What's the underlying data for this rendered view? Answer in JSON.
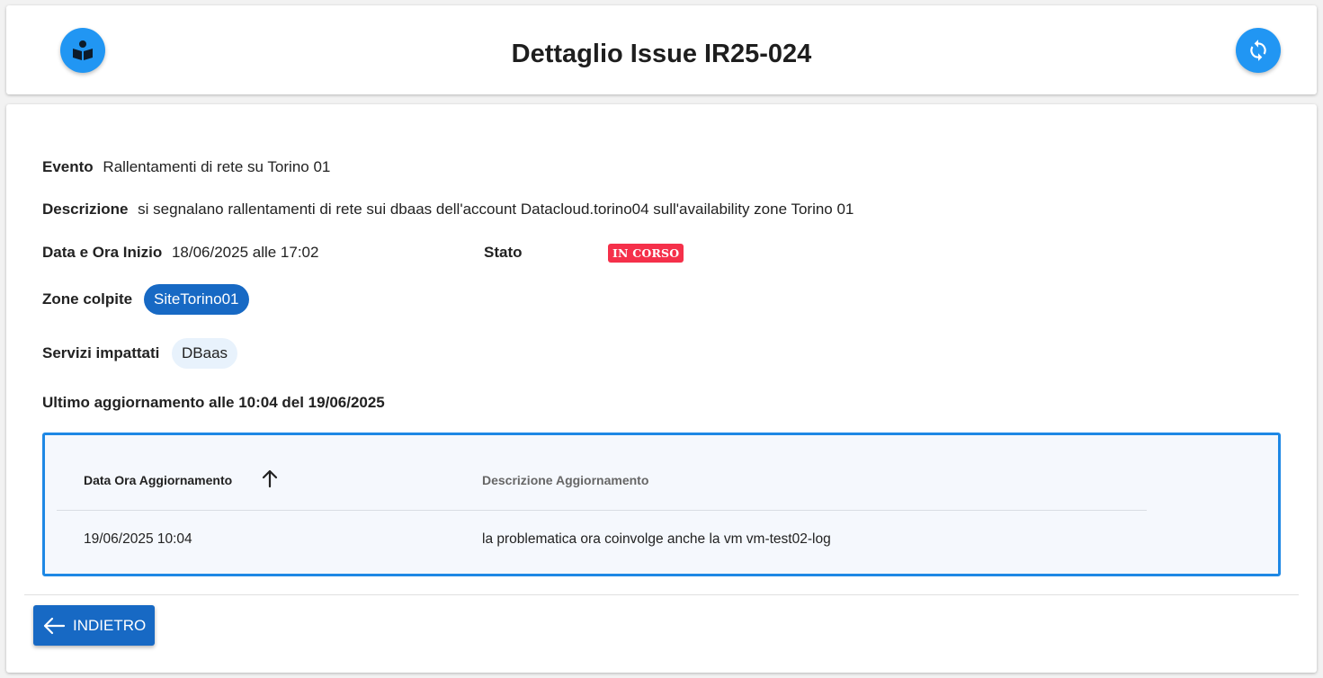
{
  "header": {
    "title": "Dettaglio Issue IR25-024"
  },
  "details": {
    "evento_label": "Evento",
    "evento_value": "Rallentamenti di rete su Torino 01",
    "descrizione_label": "Descrizione",
    "descrizione_value": "si segnalano rallentamenti di rete sui dbaas dell'account Datacloud.torino04 sull'availability zone Torino 01",
    "data_inizio_label": "Data e Ora Inizio",
    "data_inizio_value": "18/06/2025 alle 17:02",
    "stato_label": "Stato",
    "stato_value": "IN CORSO",
    "zone_label": "Zone colpite",
    "zone_chips": [
      "SiteTorino01"
    ],
    "servizi_label": "Servizi impattati",
    "servizi_chips": [
      "DBaas"
    ],
    "ultimo_aggiornamento": "Ultimo aggiornamento alle 10:04 del 19/06/2025"
  },
  "table": {
    "columns": [
      "Data Ora Aggiornamento",
      "Descrizione Aggiornamento"
    ],
    "rows": [
      [
        "19/06/2025 10:04",
        "la problematica ora coinvolge anche la vm vm-test02-log"
      ]
    ]
  },
  "footer": {
    "back_label": "INDIETRO"
  },
  "icons": {
    "left_header": "book-reader-icon",
    "right_header": "refresh-icon",
    "sort": "arrow-up-icon",
    "back": "arrow-left-icon"
  },
  "colors": {
    "accent": "#2196f3",
    "primary_button": "#1769c4",
    "status_badge": "#f5304a",
    "table_border": "#1e88e5"
  }
}
